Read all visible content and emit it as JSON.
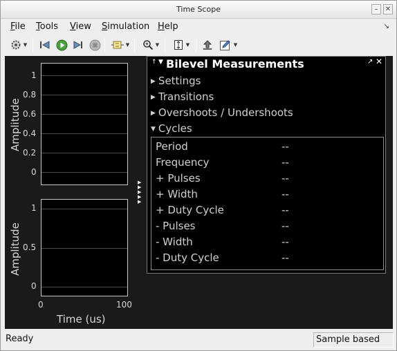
{
  "window": {
    "title": "Time Scope",
    "min_glyph": "–",
    "close_glyph": "✕"
  },
  "menu": [
    "File",
    "Tools",
    "View",
    "Simulation",
    "Help"
  ],
  "menu_mnemonics": [
    "F",
    "T",
    "V",
    "S",
    "H"
  ],
  "toolbar": {
    "icons": [
      "settings-icon",
      "step-back-icon",
      "run-icon",
      "step-forward-icon",
      "stop-icon",
      "highlight-block-icon",
      "zoom-icon",
      "scale-axes-icon",
      "send-to-back-icon",
      "edit-icon"
    ]
  },
  "plots": {
    "top": {
      "ylabel": "Amplitude",
      "yticks": [
        "1",
        "0.8",
        "0.6",
        "0.4",
        "0.2",
        "0"
      ]
    },
    "bottom": {
      "ylabel": "Amplitude",
      "yticks": [
        "1",
        "0.5",
        "0"
      ],
      "xticks": [
        "0",
        "100"
      ],
      "xlabel": "Time (us)"
    }
  },
  "panel": {
    "title": "Bilevel Measurements",
    "sections": [
      {
        "label": "Settings",
        "expanded": false
      },
      {
        "label": "Transitions",
        "expanded": false
      },
      {
        "label": "Overshoots / Undershoots",
        "expanded": false
      },
      {
        "label": "Cycles",
        "expanded": true
      }
    ],
    "cycles": [
      {
        "label": "Period",
        "value": "--"
      },
      {
        "label": "Frequency",
        "value": "--"
      },
      {
        "label": "+ Pulses",
        "value": "--"
      },
      {
        "label": "+ Width",
        "value": "--"
      },
      {
        "label": "+ Duty Cycle",
        "value": "--"
      },
      {
        "label": "- Pulses",
        "value": "--"
      },
      {
        "label": "- Width",
        "value": "--"
      },
      {
        "label": "- Duty Cycle",
        "value": "--"
      }
    ]
  },
  "status": {
    "text": "Ready",
    "mode": "Sample based"
  },
  "colors": {
    "scope_bg": "#1a1a1a",
    "axes_bg": "#000000",
    "grid": "#4a4a4a",
    "axes_border": "#c8c8c8",
    "text_light": "#d8d8d8"
  }
}
